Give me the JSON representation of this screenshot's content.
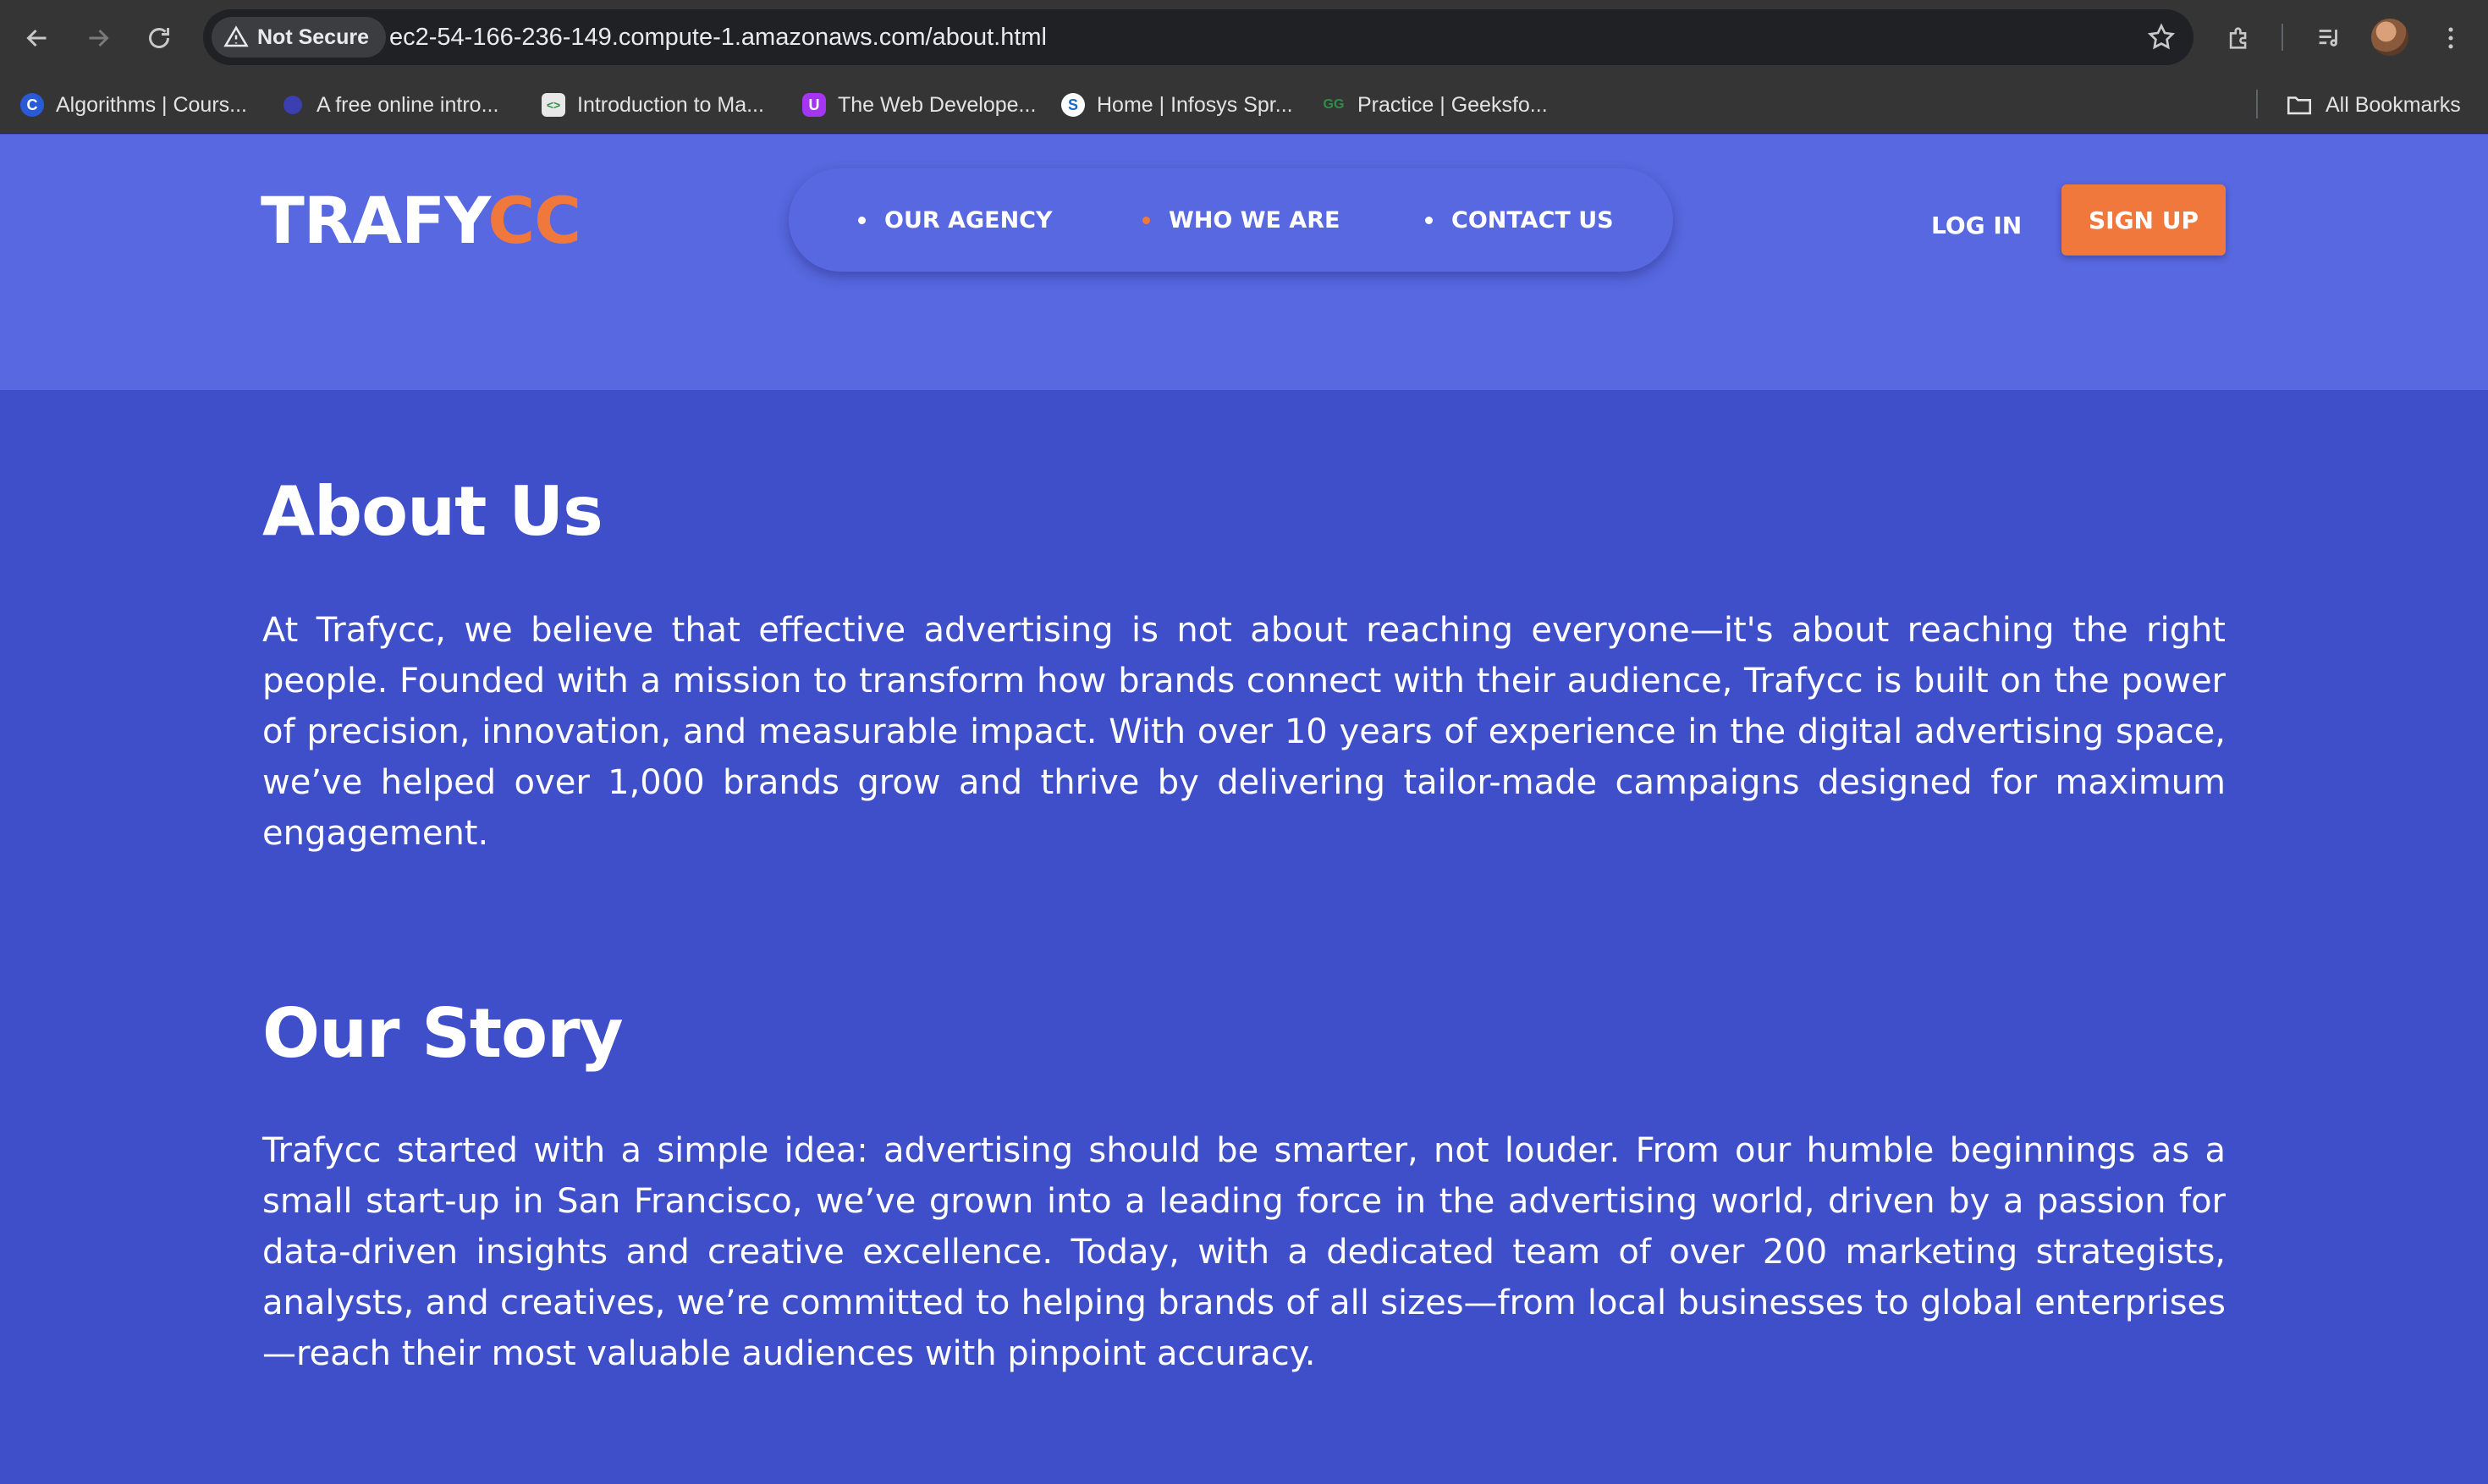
{
  "browser": {
    "security_label": "Not Secure",
    "url": "ec2-54-166-236-149.compute-1.amazonaws.com/about.html",
    "bookmarks": [
      {
        "label": "Algorithms | Cours...",
        "icon": "coursera-icon",
        "color": "#2a5bd7",
        "glyph": "C"
      },
      {
        "label": "A free online intro...",
        "icon": "dot-icon",
        "color": "#3b3fb0",
        "glyph": ""
      },
      {
        "label": "Introduction to Ma...",
        "icon": "code-icon",
        "color": "#e8e8e8",
        "glyph": "<>"
      },
      {
        "label": "The Web Develope...",
        "icon": "udemy-icon",
        "color": "#a435f0",
        "glyph": "U"
      },
      {
        "label": "Home | Infosys Spr...",
        "icon": "infosys-icon",
        "color": "#ffffff",
        "glyph": "S"
      },
      {
        "label": "Practice | Geeksfo...",
        "icon": "geeksforgeeks-icon",
        "color": "#2f8d46",
        "glyph": "GG"
      }
    ],
    "all_bookmarks_label": "All Bookmarks"
  },
  "site": {
    "logo_main": "TRAFY",
    "logo_accent": "CC",
    "nav": [
      {
        "label": "OUR AGENCY",
        "active": false
      },
      {
        "label": "WHO WE ARE",
        "active": true
      },
      {
        "label": "CONTACT US",
        "active": false
      }
    ],
    "login_label": "LOG IN",
    "signup_label": "SIGN UP",
    "accent_color": "#f0783c",
    "header_color": "#5768e0",
    "body_color": "#3f4fca"
  },
  "about": {
    "title": "About Us",
    "body": "At Trafycc, we believe that effective advertising is not about reaching everyone—it's about reaching the right people. Founded with a mission to transform how brands connect with their audience, Trafycc is built on the power of precision, innovation, and measurable impact. With over 10 years of experience in the digital advertising space, we’ve helped over 1,000 brands grow and thrive by delivering tailor-made campaigns designed for maximum engagement."
  },
  "story": {
    "title": "Our Story",
    "body": "Trafycc started with a simple idea: advertising should be smarter, not louder. From our humble beginnings as a small start-up in San Francisco, we’ve grown into a leading force in the advertising world, driven by a passion for data-driven insights and creative excellence. Today, with a dedicated team of over 200 marketing strategists, analysts, and creatives, we’re committed to helping brands of all sizes—from local businesses to global enterprises—reach their most valuable audiences with pinpoint accuracy."
  }
}
